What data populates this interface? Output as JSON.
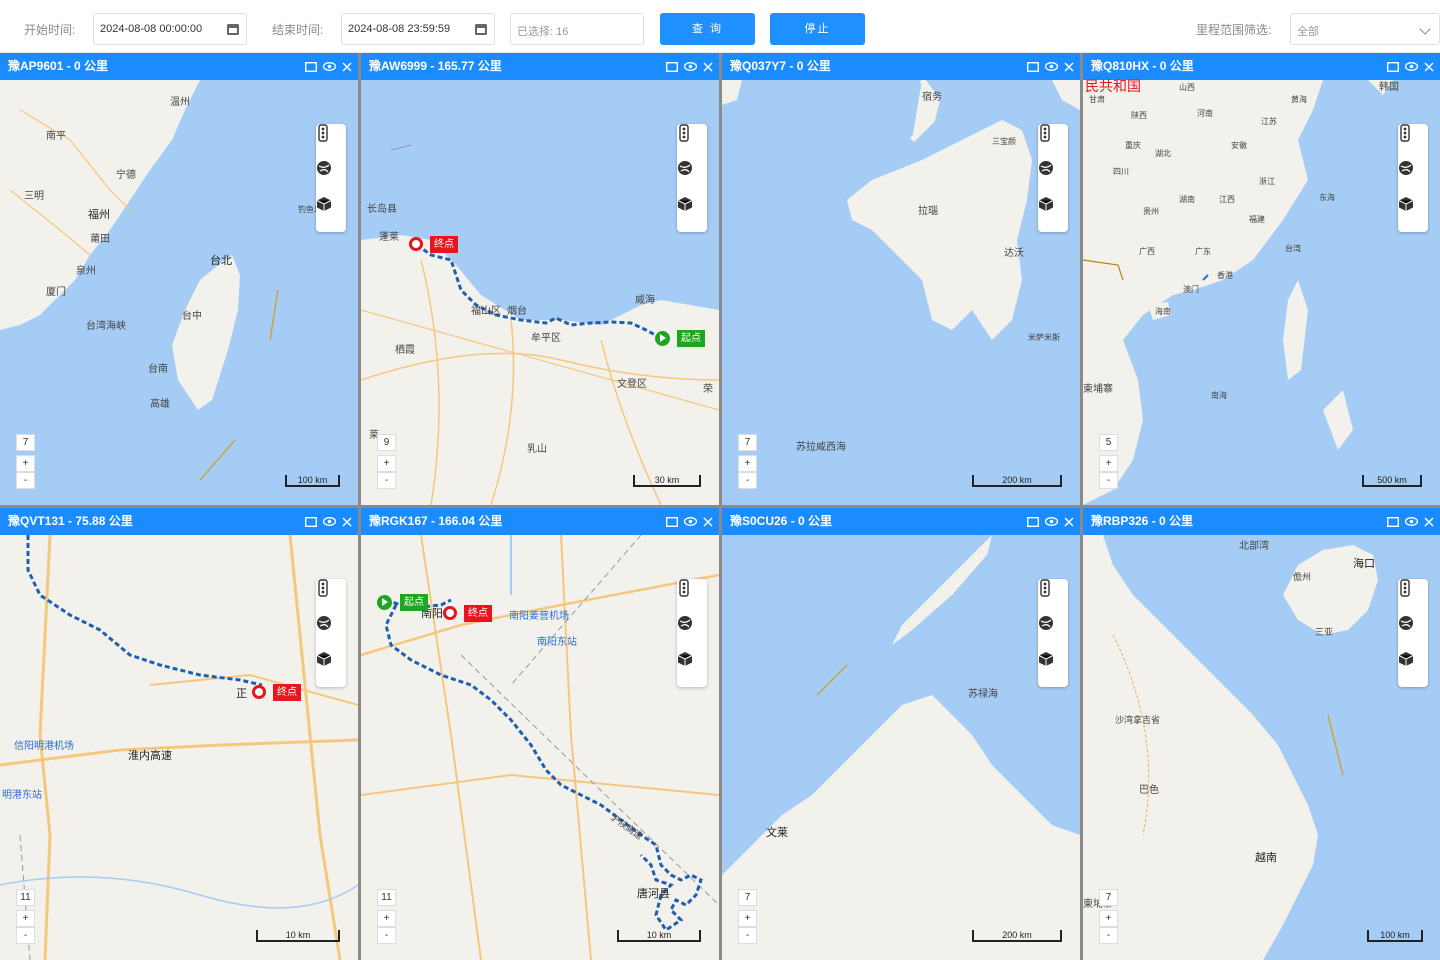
{
  "toolbar": {
    "start_label": "开始时间:",
    "start_value": "2024-08-08 00:00:00",
    "end_label": "结束时间:",
    "end_value": "2024-08-08 23:59:59",
    "selected_text": "已选择: 16",
    "query_button": "查 询",
    "stop_button": "停止",
    "range_label": "里程范围筛选:",
    "range_value": "全部"
  },
  "panels": [
    {
      "title": "豫AP9601 - 0 公里",
      "zoom": "7",
      "scale": "100 km",
      "labels": [
        "福州",
        "南平",
        "三明",
        "宁德",
        "莆田",
        "泉州",
        "厦门",
        "台北",
        "台中",
        "台南",
        "台湾海峡",
        "高雄",
        "温州",
        "钓鱼岛"
      ]
    },
    {
      "title": "豫AW6999 - 165.77 公里",
      "zoom": "9",
      "scale": "30 km",
      "labels": [
        "长岛县",
        "蓬莱",
        "栖霞",
        "牟平区",
        "烟台",
        "威海",
        "文登区",
        "乳山",
        "福山区",
        "莱",
        "荣"
      ],
      "end_tag": "终点",
      "start_tag": "起点"
    },
    {
      "title": "豫Q037Y7 - 0 公里",
      "zoom": "7",
      "scale": "200 km",
      "labels": [
        "宿务",
        "拉瑙",
        "达沃",
        "苏拉威西海",
        "三宝颜",
        "米萨米斯"
      ]
    },
    {
      "title": "豫Q810HX - 0 公里",
      "zoom": "5",
      "scale": "500 km",
      "labels": [
        "民共和国",
        "韩国",
        "黄海",
        "东海",
        "南海",
        "柬埔寨",
        "台湾",
        "广东",
        "福建",
        "江西",
        "浙江",
        "湖南",
        "湖北",
        "河南",
        "贵州",
        "广西",
        "海南",
        "香港",
        "澳门",
        "安徽",
        "江苏",
        "陕西",
        "甘肃",
        "四川",
        "重庆",
        "山西"
      ]
    },
    {
      "title": "豫QVT131 - 75.88 公里",
      "zoom": "11",
      "scale": "10 km",
      "labels": [
        "正",
        "淮内高速",
        "信阳明港机场",
        "明港东站"
      ],
      "end_tag": "终点"
    },
    {
      "title": "豫RGK167 - 166.04 公里",
      "zoom": "11",
      "scale": "10 km",
      "labels": [
        "南阳",
        "南阳姜营机场",
        "南阳东站",
        "唐河县",
        "沪陕高速"
      ],
      "end_tag": "终点",
      "start_tag": "起点"
    },
    {
      "title": "豫S0CU26 - 0 公里",
      "zoom": "7",
      "scale": "200 km",
      "labels": [
        "苏禄海",
        "文莱"
      ]
    },
    {
      "title": "豫RBP326 - 0 公里",
      "zoom": "7",
      "scale": "100 km",
      "labels": [
        "北部湾",
        "海口",
        "儋州",
        "三亚",
        "沙湾拿吉省",
        "巴色",
        "越南",
        "柬埔寨"
      ]
    }
  ],
  "colors": {
    "header": "#1a8cff",
    "button": "#1e90ff",
    "sea": "#a5ccf4",
    "land": "#f3f1ec",
    "route": "#1f5fb0",
    "end": "#e8151f",
    "start": "#1fa51f"
  }
}
